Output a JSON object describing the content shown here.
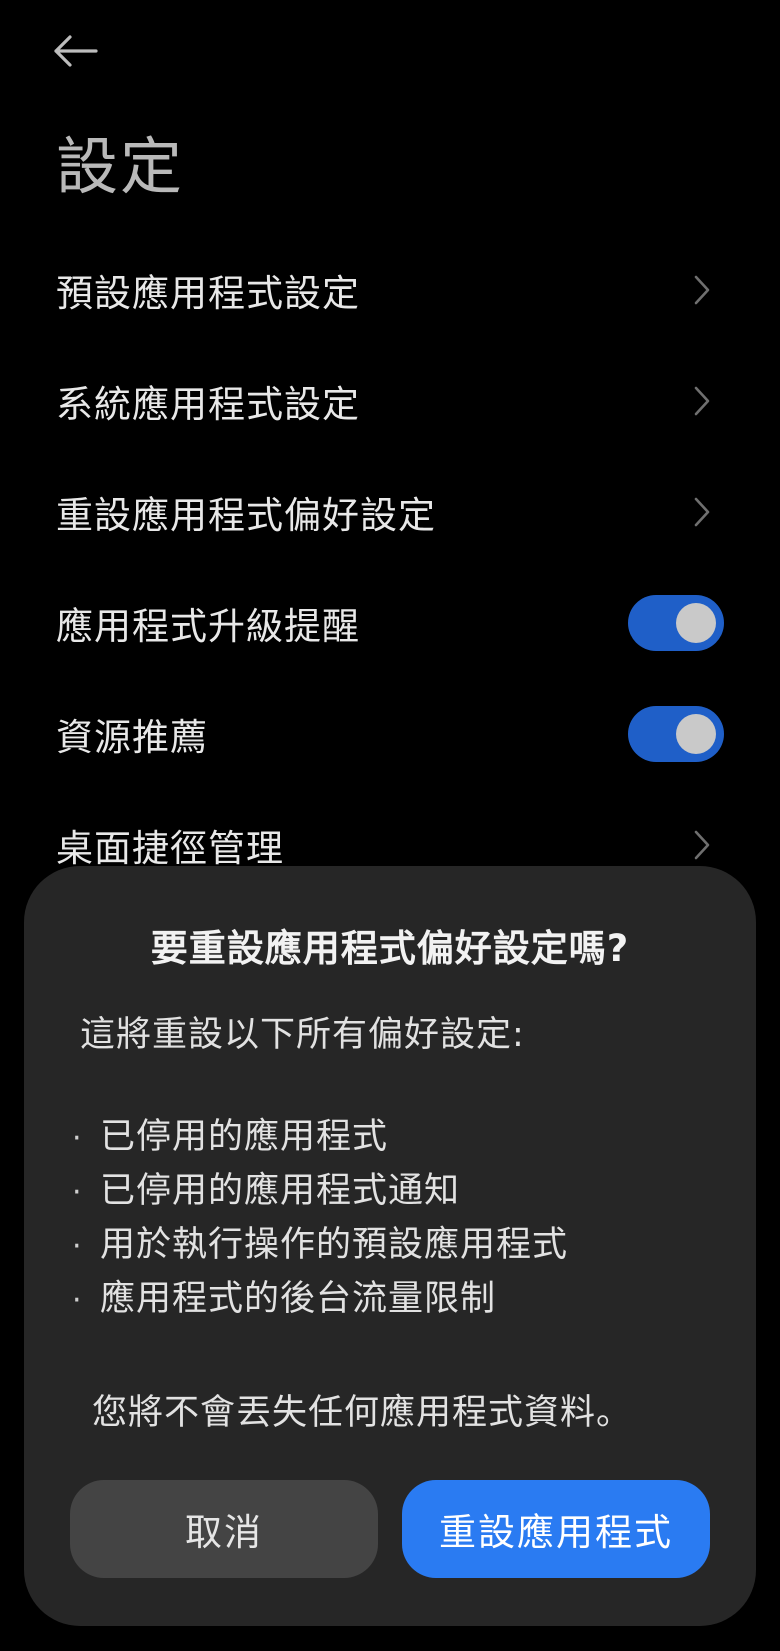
{
  "header": {
    "back_icon": "arrow-left-icon",
    "title": "設定"
  },
  "settings": [
    {
      "label": "預設應用程式設定",
      "control": "chevron"
    },
    {
      "label": "系統應用程式設定",
      "control": "chevron"
    },
    {
      "label": "重設應用程式偏好設定",
      "control": "chevron"
    },
    {
      "label": "應用程式升級提醒",
      "control": "toggle",
      "on": true
    },
    {
      "label": "資源推薦",
      "control": "toggle",
      "on": true
    },
    {
      "label": "桌面捷徑管理",
      "control": "chevron"
    }
  ],
  "dialog": {
    "title": "要重設應用程式偏好設定嗎?",
    "intro": "這將重設以下所有偏好設定:",
    "bullet_char": "·",
    "bullets": [
      "已停用的應用程式",
      "已停用的應用程式通知",
      "用於執行操作的預設應用程式",
      "應用程式的後台流量限制"
    ],
    "note": "您將不會丟失任何應用程式資料。",
    "cancel_label": "取消",
    "confirm_label": "重設應用程式"
  },
  "colors": {
    "background": "#000000",
    "dialog": "#262626",
    "toggle_on": "#1f5fc8",
    "confirm_button": "#2a7bf2",
    "cancel_button": "#444444"
  }
}
